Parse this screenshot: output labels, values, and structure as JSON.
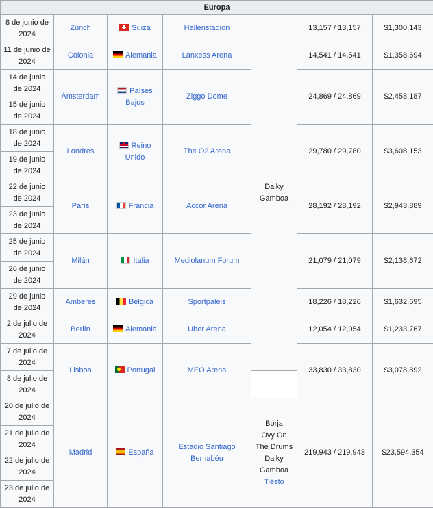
{
  "region": "Europa",
  "dates": [
    "8 de junio de 2024",
    "11 de junio de 2024",
    "14 de junio de 2024",
    "15 de junio de 2024",
    "18 de junio de 2024",
    "19 de junio de 2024",
    "22 de junio de 2024",
    "23 de junio de 2024",
    "25 de junio de 2024",
    "26 de junio de 2024",
    "29 de junio de 2024",
    "2 de julio de 2024",
    "7 de julio de 2024",
    "8 de julio de 2024",
    "20 de julio de 2024",
    "21 de julio de 2024",
    "22 de julio de 2024",
    "23 de julio de 2024"
  ],
  "cities": [
    "Zúrich",
    "Colonia",
    "Ámsterdam",
    "Londres",
    "París",
    "Milán",
    "Amberes",
    "Berlín",
    "Lisboa",
    "Madrid"
  ],
  "countries": [
    "Suiza",
    "Alemania",
    "Países Bajos",
    "Reino Unido",
    "Francia",
    "Italia",
    "Bélgica",
    "Alemania",
    "Portugal",
    "España"
  ],
  "country_flags": [
    "switzerland-flag",
    "germany-flag",
    "netherlands-flag",
    "united-kingdom-flag",
    "france-flag",
    "italy-flag",
    "belgium-flag",
    "germany-flag",
    "portugal-flag",
    "spain-flag"
  ],
  "venues": [
    "Hallenstadion",
    "Lanxess Arena",
    "Ziggo Dome",
    "The O2 Arena",
    "Accor Arena",
    "Mediolanum Forum",
    "Sportpaleis",
    "Uber Arena",
    "MEO Arena",
    "Estadio Santiago Bernabéu"
  ],
  "attendance": [
    "13,157 / 13,157",
    "14,541 / 14,541",
    "24,869 / 24,869",
    "29,780 / 29,780",
    "28,192 / 28,192",
    "21,079 / 21,079",
    "18,226 / 18,226",
    "12,054 / 12,054",
    "33,830 / 33,830",
    "219,943 / 219,943"
  ],
  "revenue": [
    "$1,300,143",
    "$1,358,694",
    "$2,458,187",
    "$3,608,153",
    "$2,943,889",
    "$2,138,672",
    "$1,632,695",
    "$1,233,767",
    "$3,078,892",
    "$23,594,354"
  ],
  "opening_acts": {
    "group1": "Daiky Gamboa",
    "group2_lines": [
      "Borja",
      "Ovy On The Drums",
      "Daiky Gamboa"
    ],
    "group2_link": "Tiësto"
  },
  "colors": {
    "link": "#3366cc",
    "header_bg": "#eaecf0",
    "cell_bg": "#f8f9fa",
    "border": "#a2a9b1"
  }
}
